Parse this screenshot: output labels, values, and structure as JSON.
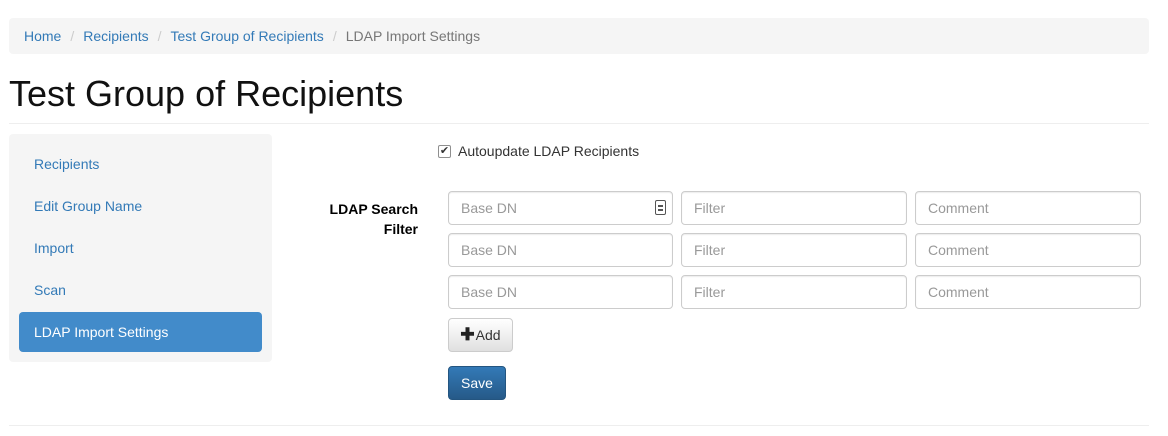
{
  "breadcrumb": {
    "items": [
      "Home",
      "Recipients",
      "Test Group of Recipients"
    ],
    "separator": "/",
    "active": "LDAP Import Settings"
  },
  "page": {
    "title": "Test Group of Recipients"
  },
  "sidebar": {
    "items": [
      {
        "label": "Recipients"
      },
      {
        "label": "Edit Group Name"
      },
      {
        "label": "Import"
      },
      {
        "label": "Scan"
      },
      {
        "label": "LDAP Import Settings",
        "active": true
      }
    ]
  },
  "form": {
    "autoupdate": {
      "label": "Autoupdate LDAP Recipients",
      "checked": true
    },
    "search_filter_label_line1": "LDAP Search",
    "search_filter_label_line2": "Filter",
    "rows": [
      {
        "base_dn": "",
        "filter": "",
        "comment": ""
      },
      {
        "base_dn": "",
        "filter": "",
        "comment": ""
      },
      {
        "base_dn": "",
        "filter": "",
        "comment": ""
      }
    ],
    "placeholders": {
      "base_dn": "Base DN",
      "filter": "Filter",
      "comment": "Comment"
    },
    "add_label": "Add",
    "save_label": "Save"
  },
  "icons": {
    "checkbox": "check-icon",
    "add": "plus-icon",
    "autofill": "autofill-contact-icon"
  },
  "colors": {
    "link": "#337ab7",
    "active_nav": "#428bca",
    "primary_button": "#337ab7"
  }
}
